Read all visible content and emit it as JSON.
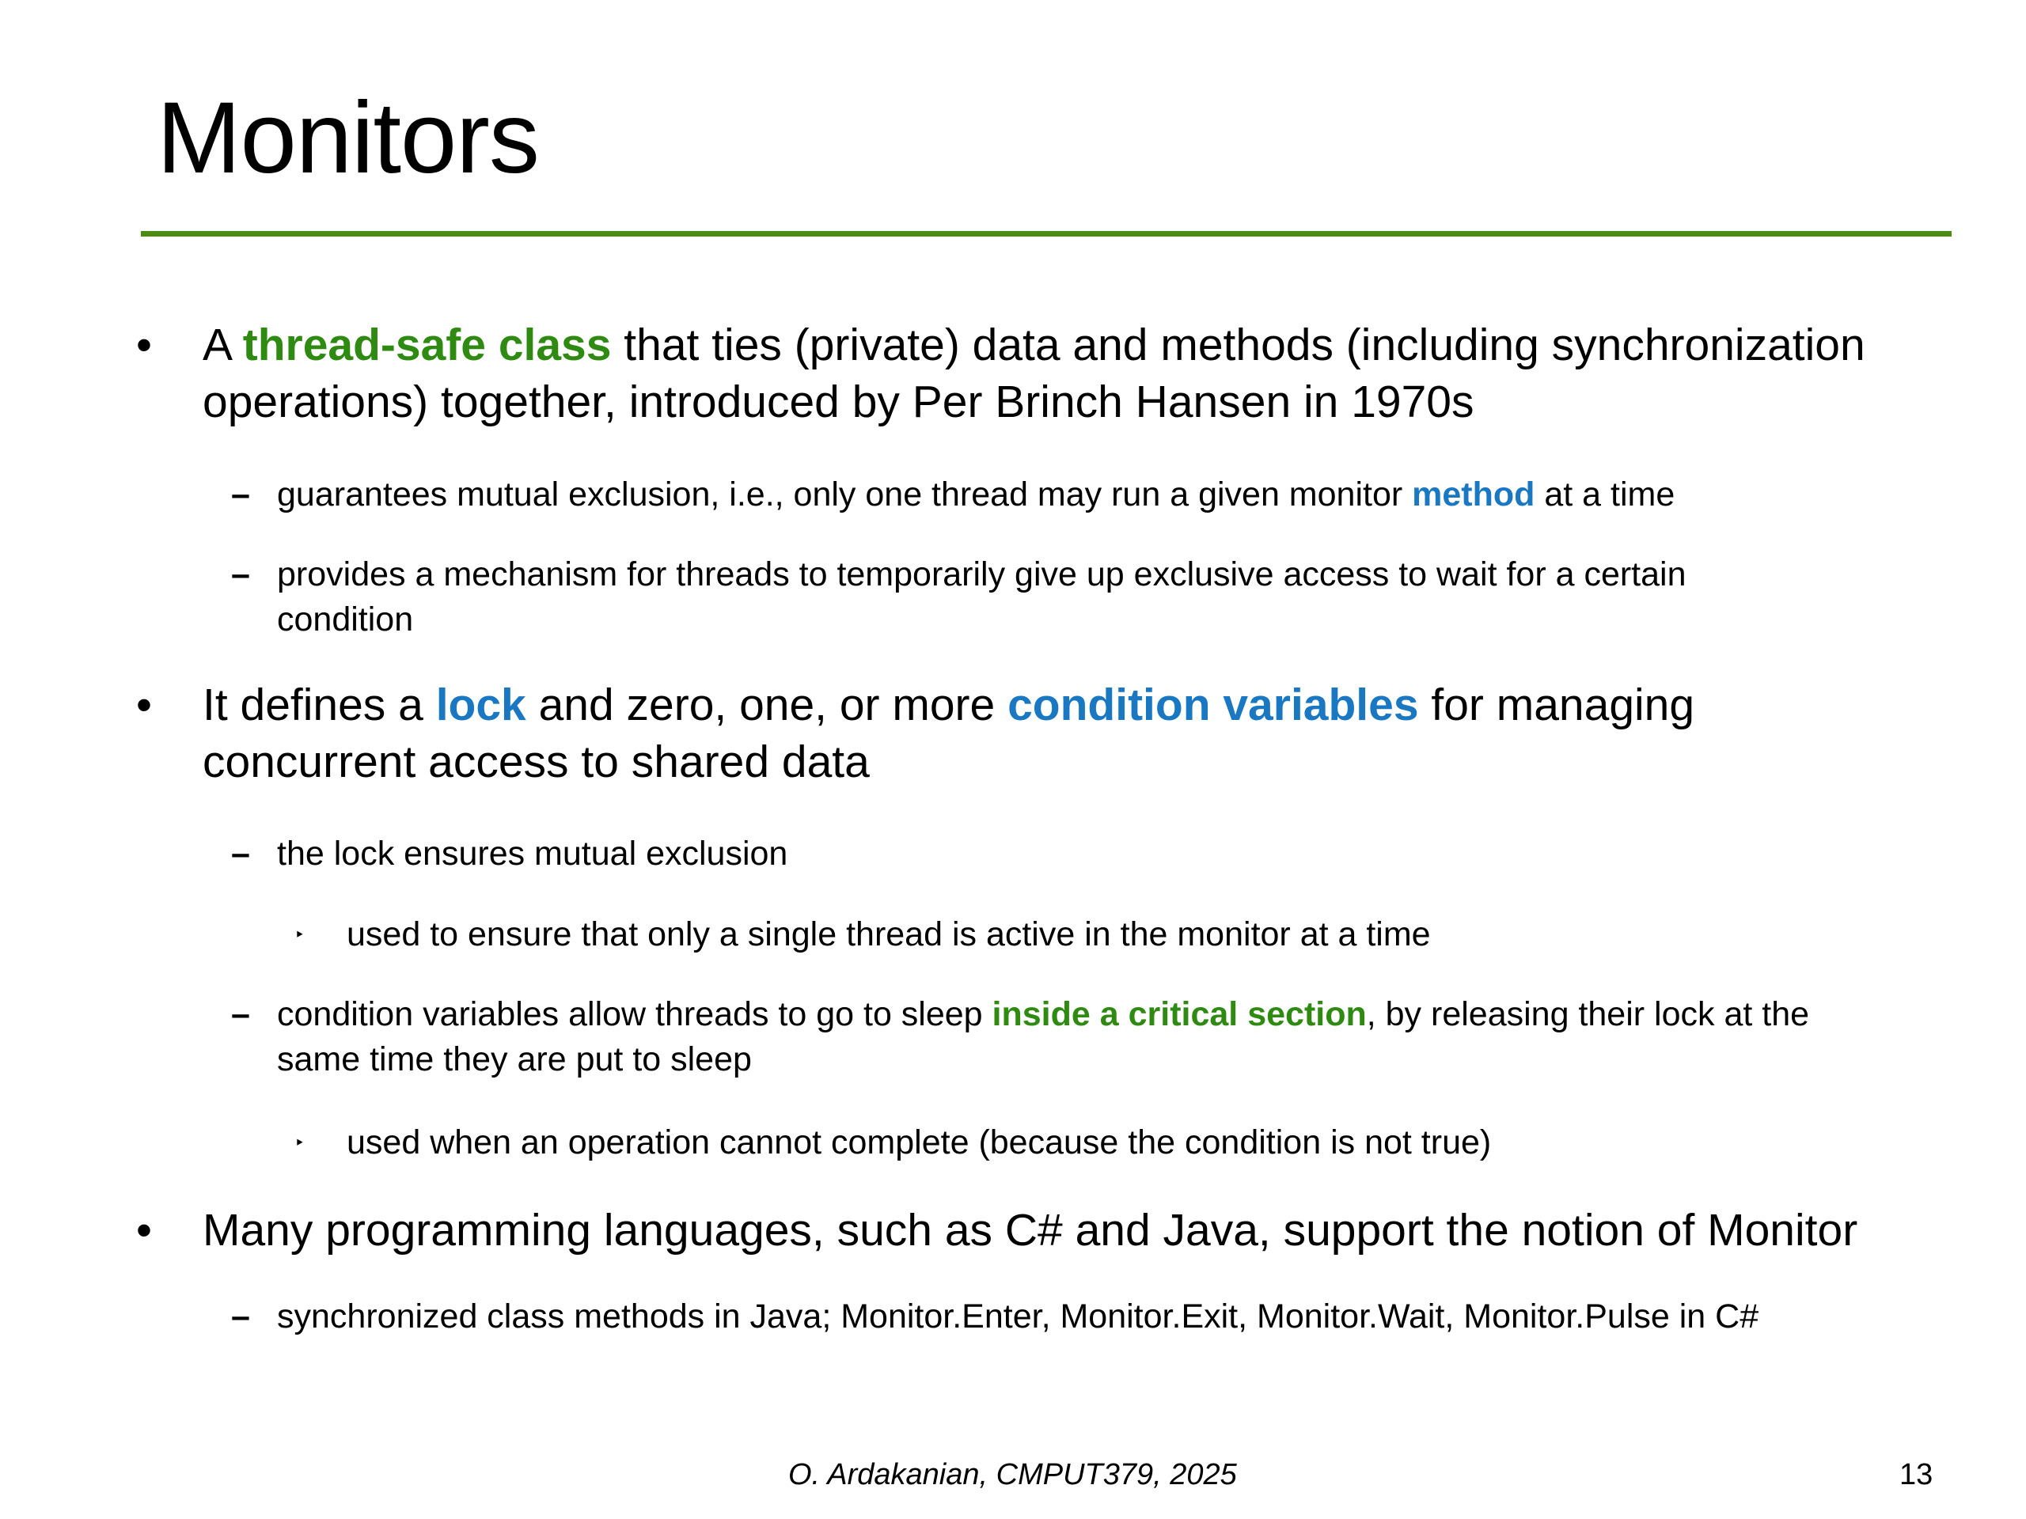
{
  "slide": {
    "title": "Monitors",
    "accent_color": "#4a8d12",
    "highlight_green": "#2f8a12",
    "highlight_blue": "#1a78c2",
    "bullets": [
      {
        "marker": "•",
        "line1": {
          "pre": "A ",
          "highlight": "thread-safe class",
          "post": " that ties (private) data and methods (including synchronization"
        },
        "line2": "operations) together, introduced by Per Brinch Hansen in 1970s",
        "subitems": [
          {
            "marker": "–",
            "pre": "guarantees mutual exclusion, i.e., only one thread may run a given monitor ",
            "highlight": "method",
            "post": " at a time"
          },
          {
            "marker": "–",
            "line1": "provides a mechanism for threads to temporarily give up exclusive access to wait for a certain",
            "line2": "condition"
          }
        ]
      },
      {
        "marker": "•",
        "line1": {
          "pre": "It defines a ",
          "highlight1": "lock",
          "mid": " and zero, one, or more ",
          "highlight2": "condition variables",
          "post": " for managing"
        },
        "line2": "concurrent access to shared data",
        "subitems": [
          {
            "marker": "–",
            "text": "the lock ensures mutual exclusion",
            "subsub": {
              "marker": "‣",
              "text": "used to ensure that only a single thread is active in the monitor at a time"
            }
          },
          {
            "marker": "–",
            "line1": {
              "pre": "condition variables allow threads to go to sleep ",
              "highlight": "inside a critical section",
              "post": ", by releasing their lock at the"
            },
            "line2": "same time they are put to sleep",
            "subsub": {
              "marker": "‣",
              "text": "used when an operation cannot complete (because the condition is not true)"
            }
          }
        ]
      },
      {
        "marker": "•",
        "text": "Many programming languages, such as C# and Java, support the notion of Monitor",
        "subitems": [
          {
            "marker": "–",
            "text": "synchronized class methods in Java; Monitor.Enter, Monitor.Exit, Monitor.Wait, Monitor.Pulse in C#"
          }
        ]
      }
    ],
    "footer": "O. Ardakanian, CMPUT379, 2025",
    "page_number": "13"
  }
}
